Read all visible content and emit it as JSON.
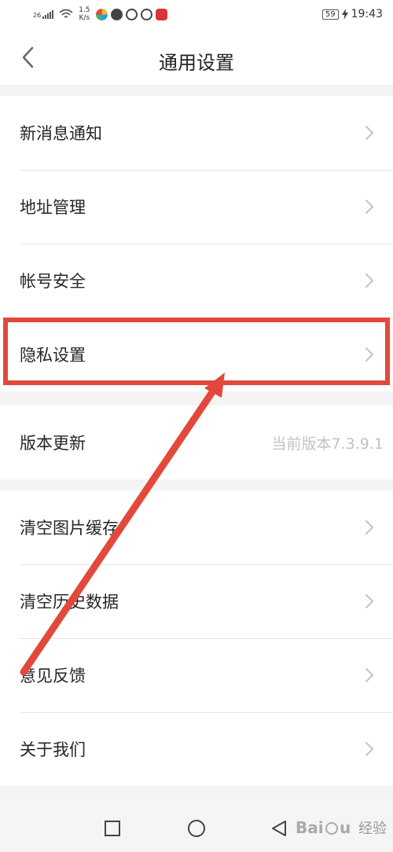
{
  "status_bar": {
    "network": "26",
    "speed_value": "1.5",
    "speed_unit": "K/s",
    "battery": "59",
    "time": "19:43"
  },
  "header": {
    "title": "通用设置"
  },
  "groups": [
    {
      "items": [
        {
          "label": "新消息通知"
        },
        {
          "label": "地址管理"
        },
        {
          "label": "帐号安全"
        },
        {
          "label": "隐私设置"
        }
      ]
    },
    {
      "items": [
        {
          "label": "版本更新",
          "value": "当前版本7.3.9.1"
        }
      ]
    },
    {
      "items": [
        {
          "label": "清空图片缓存"
        },
        {
          "label": "清空历史数据"
        },
        {
          "label": "意见反馈"
        },
        {
          "label": "关于我们"
        }
      ]
    }
  ],
  "watermark": {
    "text": "经验"
  },
  "icons": {
    "back": "chevron-left-icon",
    "row_arrow": "chevron-right-icon",
    "nav_recent": "square-icon",
    "nav_home": "circle-icon",
    "nav_back": "triangle-back-icon"
  },
  "colors": {
    "annotation": "#e2493b",
    "page_background": "#f4f4f4",
    "value_text": "#c2c2c2"
  }
}
